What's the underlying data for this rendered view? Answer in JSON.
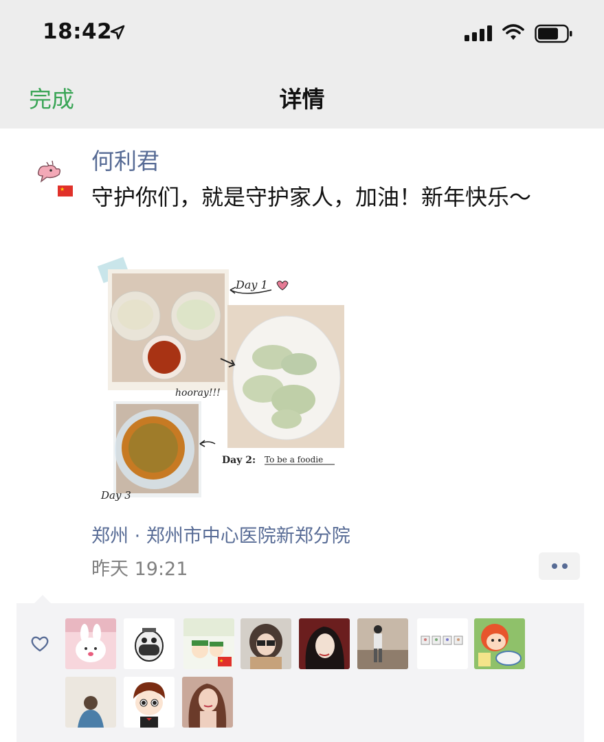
{
  "status_bar": {
    "time": "18:42"
  },
  "nav": {
    "done_label": "完成",
    "title": "详情"
  },
  "post": {
    "username": "何利君",
    "text": "守护你们，就是守护家人，加油！新年快乐～",
    "collage_labels": {
      "day1": "Day 1",
      "hooray": "hooray!!!",
      "day2": "Day 2:",
      "day2_note": "To be a foodie",
      "day3": "Day 3"
    },
    "location": "郑州 · 郑州市中心医院新郑分院",
    "timestamp": "昨天 19:21"
  },
  "likes": {
    "icon": "heart-outline-icon",
    "avatars": [
      "bunny-avatar",
      "mask-avatar",
      "green-hat-avatar",
      "girl-glasses-avatar",
      "dark-hair-avatar",
      "street-boy-avatar",
      "cats-sticker-avatar",
      "ponyo-avatar",
      "child-back-avatar",
      "cartoon-boy-avatar",
      "woman-portrait-avatar"
    ]
  },
  "colors": {
    "link_blue": "#576b95",
    "wechat_green": "#3aa556",
    "bar_bg": "#ededed"
  }
}
